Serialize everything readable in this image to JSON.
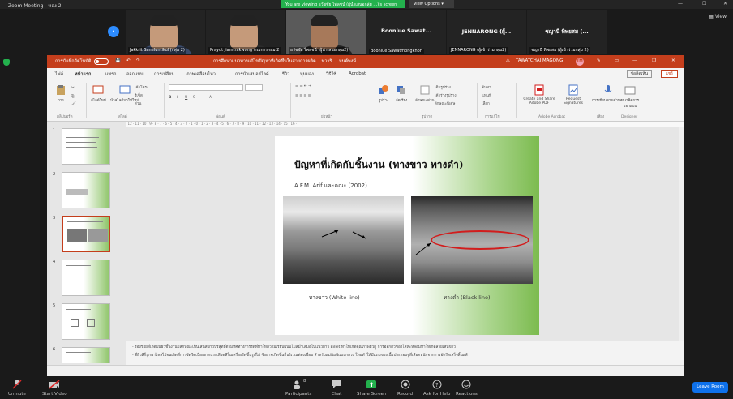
{
  "zoom": {
    "app_title": "Zoom Meeting - หอง 2",
    "viewing_banner": "You are viewing ธวัชชัย ไพลชน์ (ผู้นำเสนอกลุ่ม ...)'s screen",
    "view_options": "View Options ▾",
    "view_button": "▦ View",
    "participants": [
      {
        "label": "Jakkrit Saneluntikul (กลุ่ม 2)",
        "type": "video"
      },
      {
        "label": "Prayut Jiamtrakwong กรมการกลุ่ม 2",
        "type": "video"
      },
      {
        "label": "ธวัชชัย ไพลชน์ (ผู้นำเสนอกลุ่ม2)",
        "type": "video"
      },
      {
        "name": "Boonlue Sawat...",
        "label": "Boonlue Sawatmongkhon",
        "type": "name"
      },
      {
        "name": "JENNARONG (ผู้...",
        "label": "JENNARONG (ผู้เข้าร่วมกลุ่ม2)",
        "type": "name"
      },
      {
        "name": "ชญานี ทิพยสม (...",
        "label": "ชญานี ทิพยสม (ผู้เข้าร่วมกลุ่ม 2)",
        "type": "name"
      }
    ],
    "bottom": {
      "unmute": "Unmute",
      "start_video": "Start Video",
      "participants": "Participants",
      "participants_count": "8",
      "chat": "Chat",
      "share_screen": "Share Screen",
      "record": "Record",
      "ask_help": "Ask for Help",
      "reactions": "Reactions",
      "leave": "Leave Room"
    }
  },
  "ppt": {
    "autosave": "การบันทึกอัตโนมัติ",
    "doc_title": "การศึกษาแนวทางแก้ไขปัญหาที่เกิดขึ้นในสายการผลิต... ทวาริ ... มนต์พงษ์",
    "user": "TAWATCHAI MAGONG",
    "user_initials": "TM",
    "tabs": [
      "ไฟล์",
      "หน้าแรก",
      "แทรก",
      "ออกแบบ",
      "การเปลี่ยน",
      "ภาพเคลื่อนไหว",
      "การนำเสนอสไลด์",
      "รีวิว",
      "มุมมอง",
      "วิธีใช้",
      "Acrobat"
    ],
    "comment_btn": "ข้อคิดเห็น",
    "share_btn": "แชร์",
    "ribbon": {
      "paste": "วาง",
      "new_slide": "สไลด์ใหม่",
      "reuse": "นำสไลด์มาใช้ใหม่",
      "layout": "เค้าโครง",
      "reset": "รีเซ็ต",
      "section": "ส่วน",
      "group_clipboard": "คลิปบอร์ด",
      "group_slides": "สไลด์",
      "group_font": "ฟอนต์",
      "group_paragraph": "ย่อหน้า",
      "group_drawing": "รูปวาด",
      "group_editing": "การแก้ไข",
      "group_acrobat": "Adobe Acrobat",
      "group_voice": "เสียง",
      "group_designer": "Designer",
      "shapes": "รูปร่าง",
      "arrange": "จัดเรียง",
      "quick_styles": "ลักษณะด่วน",
      "fill": "เติมรูปร่าง",
      "outline": "เค้าร่างรูปร่าง",
      "effects": "ลักษณะพิเศษ",
      "find": "ค้นหา",
      "replace": "แทนที่",
      "select": "เลือก",
      "create_share_pdf": "Create and Share Adobe PDF",
      "request_sigs": "Request Signatures",
      "dictate": "การเขียนตามคำบอก",
      "design_ideas": "แนวคิดการออกแบบ"
    },
    "slide": {
      "title": "ปัญหาที่เกิดกับชิ้นงาน (ทางขาว ทางดำ)",
      "subtitle": "A.F.M. Arif และคณะ (2002)",
      "caption_left": "ทางขาว (White line)",
      "caption_right": "ทางดำ (Black line)"
    },
    "slide_numbers": [
      "1",
      "2",
      "3",
      "4",
      "5",
      "6"
    ],
    "selected_slide": 3,
    "notes": [
      "- ร่องรอยที่เกิดบนผิวชิ้นงานมีลักษณะเป็นเส้นสีขาวบริสุทธิ์ตามทิศทางการรีดที่ทำให้ความเรียบแบบไม่สม่ำเสมอในแนวยาว Billet ทำให้เกิดคุณภาพผิวดู การออกตัวของโลหะหลอมทำให้เกิดลายเส้นขาว",
      "- ที่ผิวสีก็ถูกพาไหลไปจนเกิดที่การจัดรีดเนื่องจากแรงเสียดสีในเครื่องรีดขึ้นรูปไม่ ซึ่งอาจเกิดขึ้นที่บริเวณท่องเชื่อม สำหรับแม่พิมพ์แบบกลวง โดยทำให้มีแถบของเนื้อประกอบจู่ที่เสียดหนักจากการอัดรีดเสร็จสิ้นแล้ว"
    ]
  },
  "colors": {
    "ppt_red": "#c43e1c",
    "zoom_green": "#23b14d",
    "zoom_blue": "#0e71eb",
    "ellipse_red": "#d21d1d"
  }
}
